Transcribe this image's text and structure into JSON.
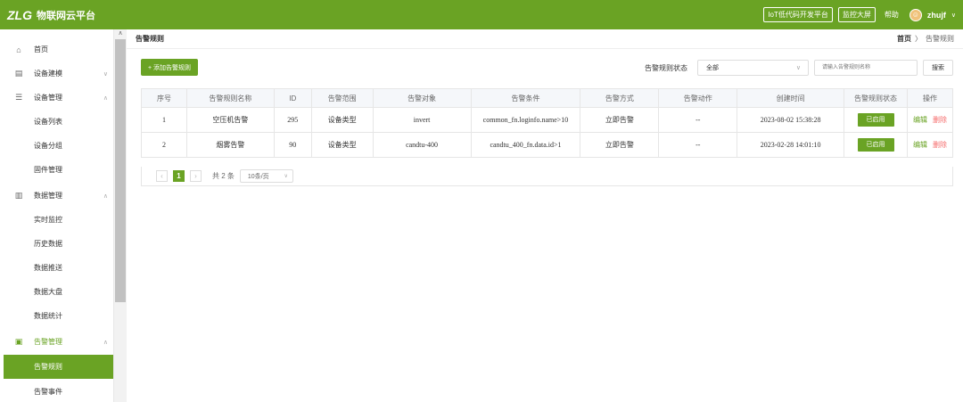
{
  "topbar": {
    "logo": "ZLG",
    "app_name": "物联网云平台",
    "btn_lowcode": "IoT低代码开发平台",
    "btn_dashboard": "监控大屏",
    "help": "帮助",
    "username": "zhujf"
  },
  "sidebar": {
    "items": [
      {
        "label": "首页",
        "icon": "home-icon"
      },
      {
        "label": "设备建模",
        "icon": "model-icon"
      },
      {
        "label": "设备管理",
        "icon": "device-icon"
      },
      {
        "label": "设备列表"
      },
      {
        "label": "设备分组"
      },
      {
        "label": "固件管理"
      },
      {
        "label": "数据管理",
        "icon": "chart-icon"
      },
      {
        "label": "实时监控"
      },
      {
        "label": "历史数据"
      },
      {
        "label": "数据推送"
      },
      {
        "label": "数据大盘"
      },
      {
        "label": "数据统计"
      },
      {
        "label": "告警管理",
        "icon": "alarm-icon"
      },
      {
        "label": "告警规则"
      },
      {
        "label": "告警事件"
      }
    ]
  },
  "header": {
    "title": "告警规则",
    "breadcrumb_home": "首页",
    "breadcrumb_sep": "〉",
    "breadcrumb_current": "告警规则"
  },
  "toolbar": {
    "add_label": "+ 添加告警规则",
    "filter_label": "告警规则状态",
    "filter_value": "全部",
    "search_placeholder": "请输入告警规则名称",
    "search_label": "搜索"
  },
  "table": {
    "columns": [
      "序号",
      "告警规则名称",
      "ID",
      "告警范围",
      "告警对象",
      "告警条件",
      "告警方式",
      "告警动作",
      "创建时间",
      "告警规则状态",
      "操作"
    ],
    "rows": [
      {
        "idx": "1",
        "name": "空压机告警",
        "id": "295",
        "scope": "设备类型",
        "target": "invert",
        "condition": "common_fn.loginfo.name>10",
        "method": "立即告警",
        "action": "--",
        "created": "2023-08-02 15:38:28",
        "status": "已启用",
        "edit": "编辑",
        "delete": "删除"
      },
      {
        "idx": "2",
        "name": "烟雾告警",
        "id": "90",
        "scope": "设备类型",
        "target": "candtu-400",
        "condition": "candtu_400_fn.data.id>1",
        "method": "立即告警",
        "action": "--",
        "created": "2023-02-28 14:01:10",
        "status": "已启用",
        "edit": "编辑",
        "delete": "删除"
      }
    ]
  },
  "pager": {
    "current": "1",
    "total": "共 2 条",
    "page_size": "10条/页"
  },
  "colors": {
    "accent": "#6aa324",
    "danger": "#f56c6c"
  }
}
